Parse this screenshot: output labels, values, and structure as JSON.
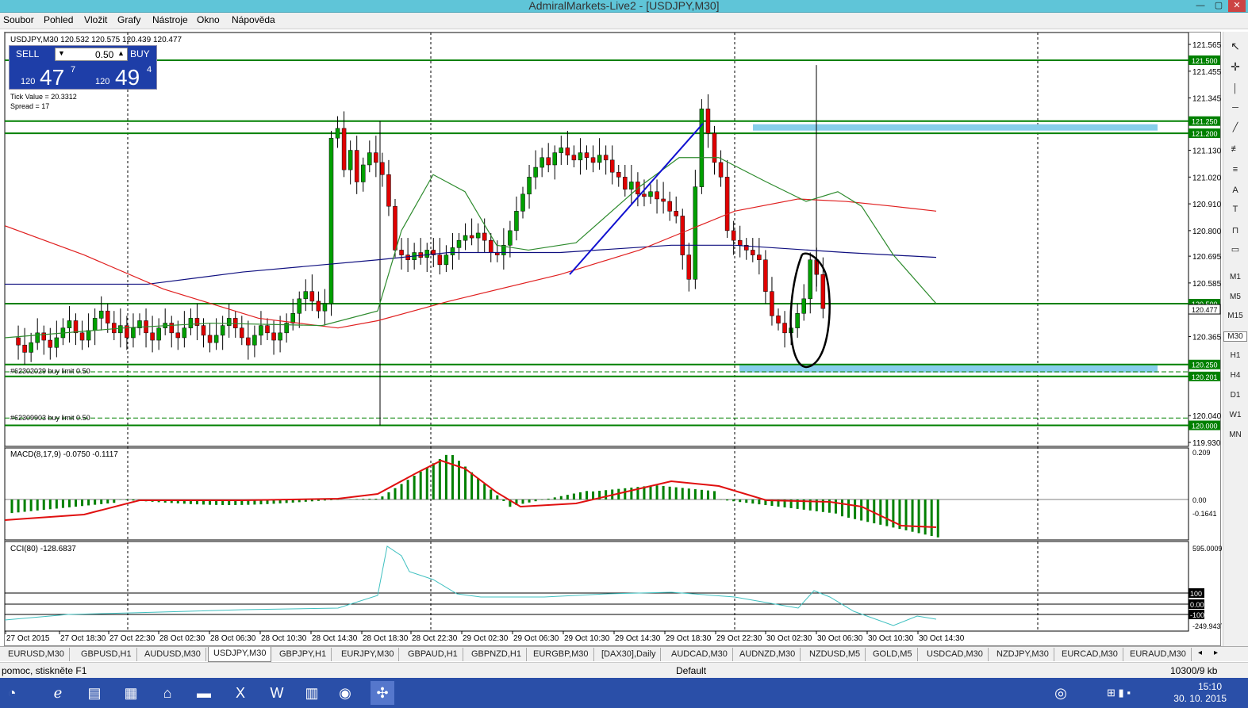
{
  "window": {
    "title": "AdmiralMarkets-Live2 - [USDJPY,M30]"
  },
  "menu": [
    "Soubor",
    "Pohled",
    "Vložit",
    "Grafy",
    "Nástroje",
    "Okno",
    "Nápověda"
  ],
  "chart": {
    "header": "USDJPY,M30  120.532 120.575 120.439 120.477",
    "tick_value": "Tick Value = 20.3312",
    "spread": "Spread = 17",
    "order1": "#62302029 buy limit 0.50",
    "order2": "#62309903 buy limit 0.50",
    "macd_label": "MACD(8,17,9) -0.0750 -0.1117",
    "cci_label": "CCI(80) -128.6837",
    "colors": {
      "bull": "#00a000",
      "bear": "#e00000",
      "level": "#008000",
      "zone": "#87ceeb",
      "ma_fast": "#2e8b2e",
      "ma_mid": "#e02020",
      "ma_slow": "#101080",
      "trend": "#1010d0",
      "cci": "#40c0c0"
    }
  },
  "trade_panel": {
    "sell_label": "SELL",
    "buy_label": "BUY",
    "lot": "0.50",
    "bid_prefix": "120",
    "bid_big": "47",
    "bid_sup": "7",
    "ask_prefix": "120",
    "ask_big": "49",
    "ask_sup": "4"
  },
  "price_axis": [
    "121.565",
    "121.455",
    "121.345",
    "121.130",
    "121.020",
    "120.910",
    "120.800",
    "120.695",
    "120.585",
    "120.365",
    "120.040",
    "119.930"
  ],
  "level_labels": [
    "121.500",
    "121.250",
    "121.200",
    "120.500",
    "120.477",
    "120.250",
    "120.201",
    "120.000"
  ],
  "macd_axis": [
    "0.209",
    "0.00",
    "-0.1641"
  ],
  "cci_axis": [
    "595.0009",
    "100",
    "0.00",
    "-100",
    "-249.9437"
  ],
  "time_axis": [
    "27 Oct 2015",
    "27 Oct 18:30",
    "27 Oct 22:30",
    "28 Oct 02:30",
    "28 Oct 06:30",
    "28 Oct 10:30",
    "28 Oct 14:30",
    "28 Oct 18:30",
    "28 Oct 22:30",
    "29 Oct 02:30",
    "29 Oct 06:30",
    "29 Oct 10:30",
    "29 Oct 14:30",
    "29 Oct 18:30",
    "29 Oct 22:30",
    "30 Oct 02:30",
    "30 Oct 06:30",
    "30 Oct 10:30",
    "30 Oct 14:30"
  ],
  "right_toolbar": {
    "timeframes": [
      "M1",
      "M5",
      "M15",
      "M30",
      "H1",
      "H4",
      "D1",
      "W1",
      "MN"
    ],
    "text_tool": "A"
  },
  "tabs": [
    "EURUSD,M30",
    "GBPUSD,H1",
    "AUDUSD,M30",
    "USDJPY,M30",
    "GBPJPY,H1",
    "EURJPY,M30",
    "GBPAUD,H1",
    "GBPNZD,H1",
    "EURGBP,M30",
    "[DAX30],Daily",
    "AUDCAD,M30",
    "AUDNZD,M30",
    "NZDUSD,M5",
    "GOLD,M5",
    "USDCAD,M30",
    "NZDJPY,M30",
    "EURCAD,M30",
    "EURAUD,M30"
  ],
  "status": {
    "help": "pomoc, stiskněte F1",
    "profile": "Default",
    "traffic": "10300/9 kb"
  },
  "taskbar": {
    "time": "15:10",
    "date": "30. 10. 2015"
  }
}
